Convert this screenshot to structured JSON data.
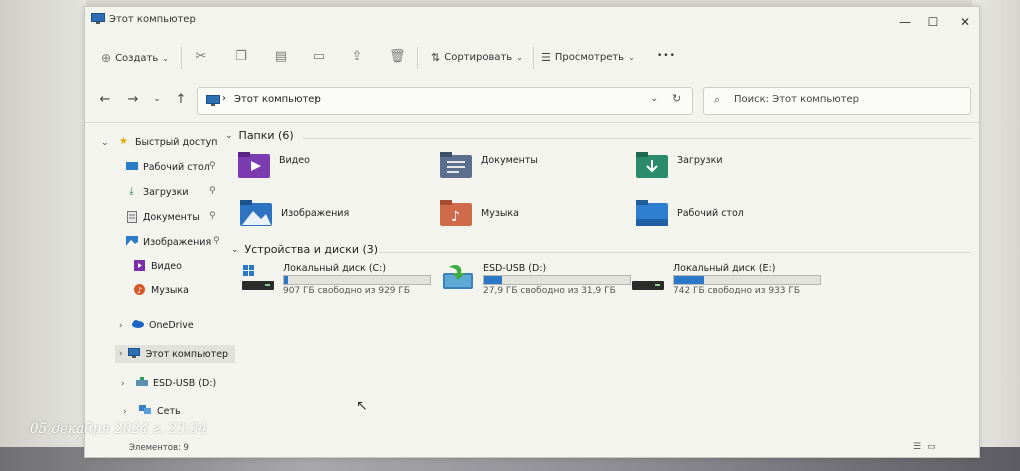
{
  "window": {
    "title": "Этот компьютер",
    "controls": {
      "minimize": "—",
      "maximize": "☐",
      "close": "✕"
    }
  },
  "commandbar": {
    "create_label": "Создать",
    "sort_label": "Сортировать",
    "view_label": "Просмотреть",
    "more_label": "•••"
  },
  "address": {
    "path": "Этот компьютер",
    "path_chevron": "›",
    "search_placeholder": "Поиск: Этот компьютер"
  },
  "sidebar": {
    "items": [
      {
        "label": "Быстрый доступ",
        "icon": "star-icon",
        "pinned": false
      },
      {
        "label": "Рабочий стол",
        "icon": "desktop-icon",
        "pinned": true
      },
      {
        "label": "Загрузки",
        "icon": "download-icon",
        "pinned": true
      },
      {
        "label": "Документы",
        "icon": "documents-icon",
        "pinned": true
      },
      {
        "label": "Изображения",
        "icon": "pictures-icon",
        "pinned": true
      },
      {
        "label": "Видео",
        "icon": "video-icon",
        "pinned": false
      },
      {
        "label": "Музыка",
        "icon": "music-icon",
        "pinned": false
      },
      {
        "label": "OneDrive",
        "icon": "cloud-icon",
        "pinned": false
      },
      {
        "label": "Этот компьютер",
        "icon": "computer-icon",
        "pinned": false
      },
      {
        "label": "ESD-USB (D:)",
        "icon": "usb-drive-icon",
        "pinned": false
      },
      {
        "label": "Сеть",
        "icon": "network-icon",
        "pinned": false
      }
    ],
    "pin_glyph": "📌"
  },
  "folders_group": {
    "header": "Папки (6)",
    "items": [
      {
        "label": "Видео",
        "icon": "video-folder-icon"
      },
      {
        "label": "Документы",
        "icon": "documents-folder-icon"
      },
      {
        "label": "Загрузки",
        "icon": "downloads-folder-icon"
      },
      {
        "label": "Изображения",
        "icon": "pictures-folder-icon"
      },
      {
        "label": "Музыка",
        "icon": "music-folder-icon"
      },
      {
        "label": "Рабочий стол",
        "icon": "desktop-folder-icon"
      }
    ]
  },
  "drives_group": {
    "header": "Устройства и диски (3)",
    "items": [
      {
        "name": "Локальный диск (C:)",
        "free_text": "907 ГБ свободно из 929 ГБ",
        "used_fraction": 0.024
      },
      {
        "name": "ESD-USB (D:)",
        "free_text": "27,9 ГБ свободно из 31,9 ГБ",
        "used_fraction": 0.125
      },
      {
        "name": "Локальный диск (E:)",
        "free_text": "742 ГБ свободно из 933 ГБ",
        "used_fraction": 0.205
      }
    ]
  },
  "status": {
    "items_count": "Элементов: 9"
  },
  "overlay": {
    "timestamp": "05 декабря 2024 г. 23:34"
  },
  "colors": {
    "accent": "#2b78c8",
    "window_bg": "#f4f4ef"
  }
}
